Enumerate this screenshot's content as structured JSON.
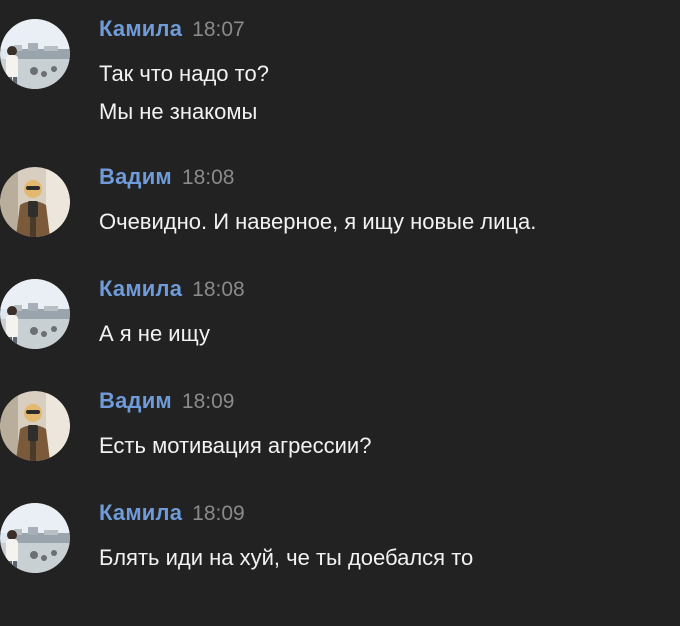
{
  "messages": [
    {
      "author": "Камила",
      "time": "18:07",
      "avatar_icon": "kamila-avatar",
      "lines": [
        "Так что надо то?",
        "Мы не знакомы"
      ]
    },
    {
      "author": "Вадим",
      "time": "18:08",
      "avatar_icon": "vadim-avatar",
      "lines": [
        "Очевидно. И наверное, я ищу новые лица."
      ]
    },
    {
      "author": "Камила",
      "time": "18:08",
      "avatar_icon": "kamila-avatar",
      "lines": [
        "А я не ищу"
      ]
    },
    {
      "author": "Вадим",
      "time": "18:09",
      "avatar_icon": "vadim-avatar",
      "lines": [
        "Есть мотивация агрессии?"
      ]
    },
    {
      "author": "Камила",
      "time": "18:09",
      "avatar_icon": "kamila-avatar",
      "lines": [
        "Блять иди на хуй, че ты доебался то"
      ]
    }
  ],
  "colors": {
    "background": "#222222",
    "author": "#6f9bd9",
    "time": "#8a8a8a",
    "text": "#f2f2f2"
  }
}
